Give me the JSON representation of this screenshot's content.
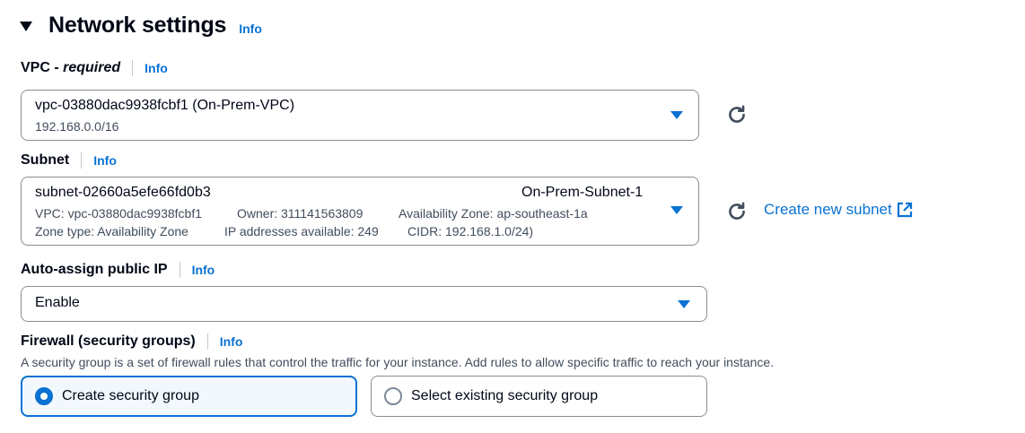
{
  "section": {
    "title": "Network settings",
    "info": "Info"
  },
  "vpc": {
    "label": "VPC - ",
    "label_required": "required",
    "info": "Info",
    "selected": "vpc-03880dac9938fcbf1 (On-Prem-VPC)",
    "cidr": "192.168.0.0/16",
    "refresh_icon": "refresh-icon"
  },
  "subnet": {
    "label": "Subnet",
    "info": "Info",
    "selected": "subnet-02660a5efe66fd0b3",
    "name": "On-Prem-Subnet-1",
    "vpc": "VPC: vpc-03880dac9938fcbf1",
    "owner": "Owner: 311141563809",
    "az": "Availability Zone: ap-southeast-1a",
    "zone_type": "Zone type: Availability Zone",
    "ips": "IP addresses available: 249",
    "cidr": "CIDR: 192.168.1.0/24)",
    "create_link": "Create new subnet",
    "external_icon": "external-link-icon"
  },
  "public_ip": {
    "label": "Auto-assign public IP",
    "info": "Info",
    "selected": "Enable"
  },
  "firewall": {
    "label": "Firewall (security groups)",
    "info": "Info",
    "description": "A security group is a set of firewall rules that control the traffic for your instance. Add rules to allow specific traffic to reach your instance.",
    "options": [
      {
        "label": "Create security group",
        "selected": true
      },
      {
        "label": "Select existing security group",
        "selected": false
      }
    ]
  },
  "colors": {
    "accent": "#0972d3",
    "text": "#000716",
    "secondary": "#414d5c",
    "border": "#8c8c94"
  }
}
